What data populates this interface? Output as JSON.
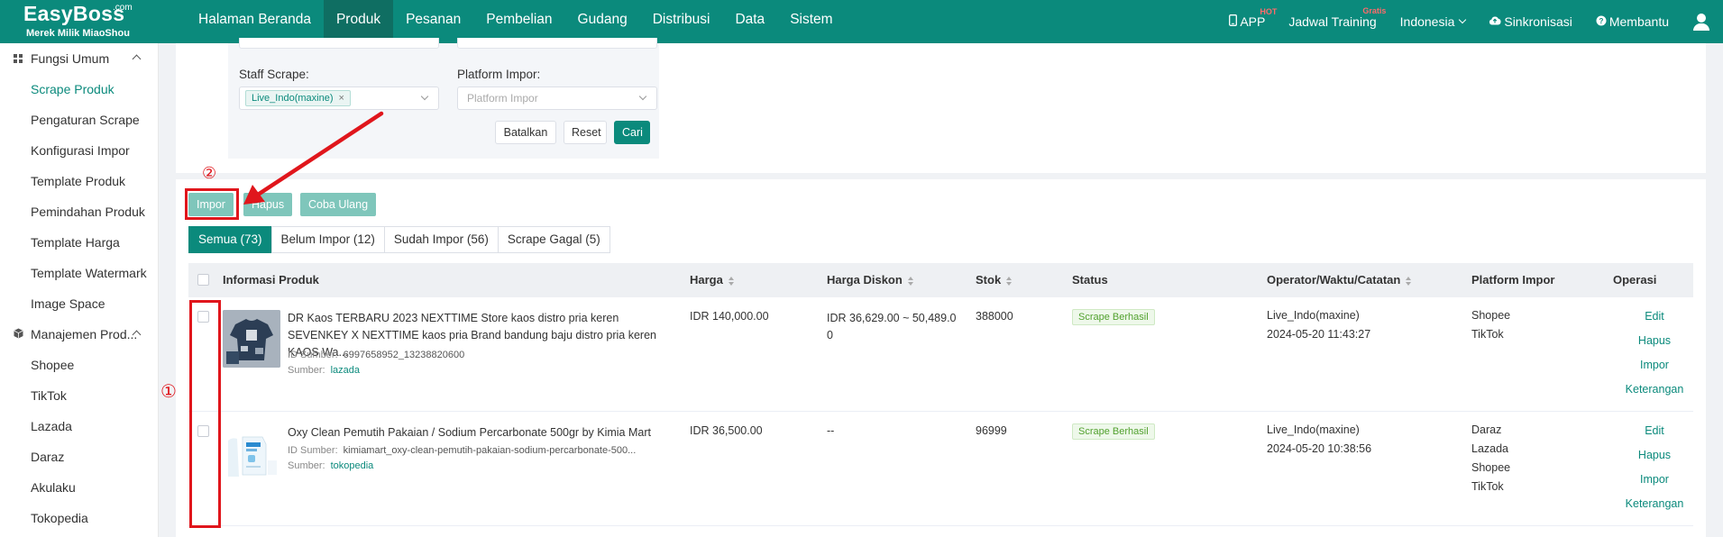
{
  "brand": {
    "name": "EasyBoss",
    "suffix": ".com",
    "tagline": "Merek Milik MiaoShou"
  },
  "nav": {
    "items": [
      "Halaman Beranda",
      "Produk",
      "Pesanan",
      "Pembelian",
      "Gudang",
      "Distribusi",
      "Data",
      "Sistem"
    ],
    "active": "Produk"
  },
  "top_right": {
    "app": "APP",
    "app_badge": "HOT",
    "training": "Jadwal Training",
    "training_badge": "Gratis",
    "language": "Indonesia",
    "sync": "Sinkronisasi",
    "help": "Membantu"
  },
  "sidebar": {
    "group1": "Fungsi Umum",
    "group1_items": [
      "Scrape Produk",
      "Pengaturan Scrape",
      "Konfigurasi Impor",
      "Template Produk",
      "Pemindahan Produk",
      "Template Harga",
      "Template Watermark",
      "Image Space"
    ],
    "active_item": "Scrape Produk",
    "group2": "Manajemen Prod...",
    "group2_items": [
      "Shopee",
      "TikTok",
      "Lazada",
      "Daraz",
      "Akulaku",
      "Tokopedia"
    ]
  },
  "filter": {
    "staff_label": "Staff Scrape:",
    "staff_tag": "Live_Indo(maxine)",
    "platform_label": "Platform Impor:",
    "platform_placeholder": "Platform Impor",
    "cancel": "Batalkan",
    "reset": "Reset",
    "search": "Cari"
  },
  "actions": {
    "import": "Impor",
    "delete": "Hapus",
    "retry": "Coba Ulang"
  },
  "tabs": [
    "Semua (73)",
    "Belum Impor (12)",
    "Sudah Impor (56)",
    "Scrape Gagal (5)"
  ],
  "active_tab": "Semua (73)",
  "table": {
    "columns": {
      "info": "Informasi Produk",
      "price": "Harga",
      "discount": "Harga Diskon",
      "stock": "Stok",
      "status": "Status",
      "operator": "Operator/Waktu/Catatan",
      "platform": "Platform Impor",
      "ops": "Operasi"
    },
    "rows": [
      {
        "title": "DR Kaos TERBARU 2023 NEXTTIME Store kaos distro pria keren SEVENKEY X NEXTTIME  kaos pria Brand bandung  baju distro pria keren  KAOS Wa...",
        "source_id_label": "ID Sumber:",
        "source_id": "6997658952_13238820600",
        "source_label": "Sumber:",
        "source": "lazada",
        "price": "IDR 140,000.00",
        "discount": "IDR 36,629.00 ~ 50,489.00",
        "stock": "388000",
        "status": "Scrape Berhasil",
        "operator": "Live_Indo(maxine)",
        "time": "2024-05-20 11:43:27",
        "platforms": [
          "Shopee",
          "TikTok"
        ],
        "ops": [
          "Edit",
          "Hapus",
          "Impor",
          "Keterangan"
        ]
      },
      {
        "title": "Oxy Clean Pemutih Pakaian / Sodium Percarbonate 500gr by Kimia Mart",
        "source_id_label": "ID Sumber:",
        "source_id": "kimiamart_oxy-clean-pemutih-pakaian-sodium-percarbonate-500...",
        "source_label": "Sumber:",
        "source": "tokopedia",
        "price": "IDR 36,500.00",
        "discount": "--",
        "stock": "96999",
        "status": "Scrape Berhasil",
        "operator": "Live_Indo(maxine)",
        "time": "2024-05-20 10:38:56",
        "platforms": [
          "Daraz",
          "Lazada",
          "Shopee",
          "TikTok"
        ],
        "ops": [
          "Edit",
          "Hapus",
          "Impor",
          "Keterangan"
        ]
      }
    ]
  },
  "annotations": {
    "step1": "①",
    "step2": "②",
    "color": "#e0161c"
  },
  "colors": {
    "primary": "#0b8a7c",
    "nav_active": "#0f6e62",
    "disabled_button": "#7fc6bb",
    "success": "#52a12f"
  }
}
